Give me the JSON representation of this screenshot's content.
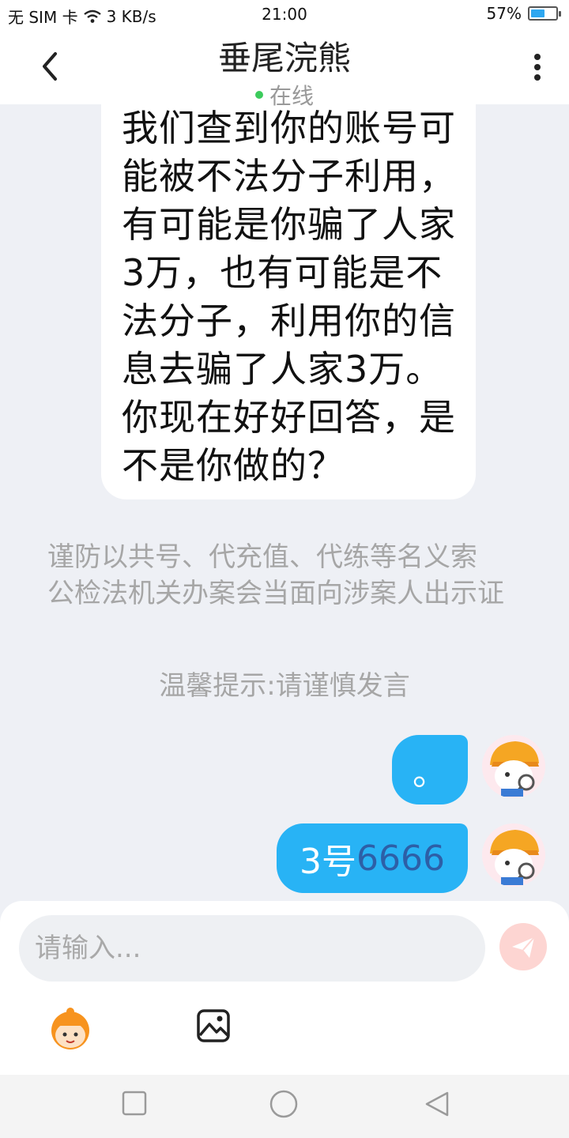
{
  "status_bar": {
    "carrier": "无 SIM 卡",
    "speed": "3 KB/s",
    "time": "21:00",
    "battery": "57%",
    "battery_level": 0.57
  },
  "header": {
    "title": "垂尾浣熊",
    "status": "在线"
  },
  "messages": {
    "incoming_text": "我们查到你的账号可能被不法分子利用，有可能是你骗了人家3万，也有可能是不法分子，利用你的信息去骗了人家3万。你现在好好回答，是不是你做的？",
    "system_notice_line1": "谨防以共号、代充值、代练等名义索",
    "system_notice_line2": "公检法机关办案会当面向涉案人出示证",
    "tip": "温馨提示:请谨慎发言",
    "out1": "。",
    "out2_prefix": "3号",
    "out2_highlight": "6666"
  },
  "input": {
    "placeholder": "请输入..."
  },
  "icons": {
    "back": "chevron-left-icon",
    "more": "more-vertical-icon",
    "send": "paper-plane-icon",
    "emoji": "emoji-icon",
    "image": "image-icon",
    "nav_recent": "square-icon",
    "nav_home": "circle-icon",
    "nav_back": "triangle-icon"
  },
  "colors": {
    "outgoing_bubble": "#28b3f5",
    "highlight_text": "#2d5fa7",
    "online_dot": "#3ccb5c",
    "send_button": "#fdd5d2",
    "background": "#eef0f5"
  }
}
